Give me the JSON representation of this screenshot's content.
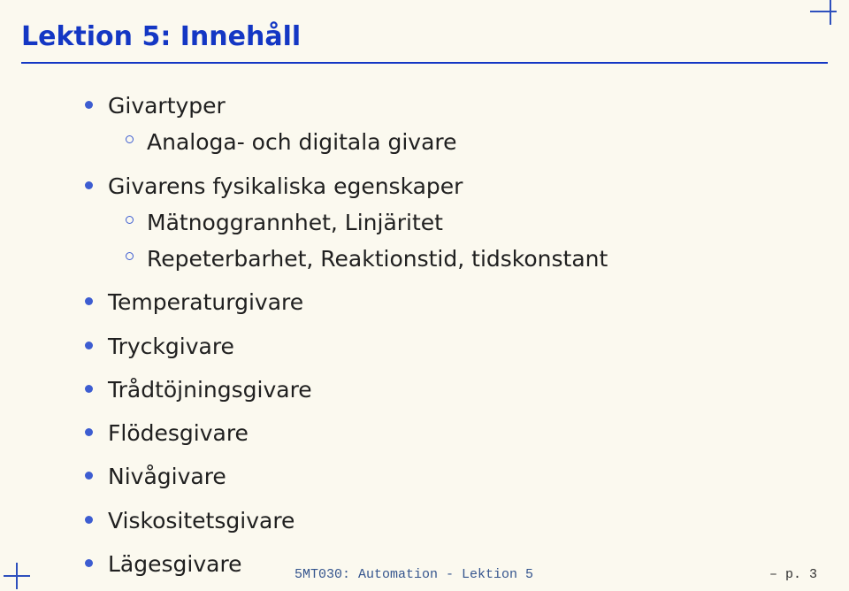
{
  "title": "Lektion 5: Innehåll",
  "bullets": {
    "b0": {
      "label": "Givartyper",
      "sub": {
        "s0": "Analoga- och digitala givare"
      }
    },
    "b1": {
      "label": "Givarens fysikaliska egenskaper",
      "sub": {
        "s0": "Mätnoggrannhet, Linjäritet",
        "s1": "Repeterbarhet, Reaktionstid, tidskonstant"
      }
    },
    "b2": {
      "label": "Temperaturgivare"
    },
    "b3": {
      "label": "Tryckgivare"
    },
    "b4": {
      "label": "Trådtöjningsgivare"
    },
    "b5": {
      "label": "Flödesgivare"
    },
    "b6": {
      "label": "Nivågivare"
    },
    "b7": {
      "label": "Viskositetsgivare"
    },
    "b8": {
      "label": "Lägesgivare"
    }
  },
  "footer": {
    "course": "5MT030: Automation - Lektion 5",
    "page": "– p. 3"
  }
}
